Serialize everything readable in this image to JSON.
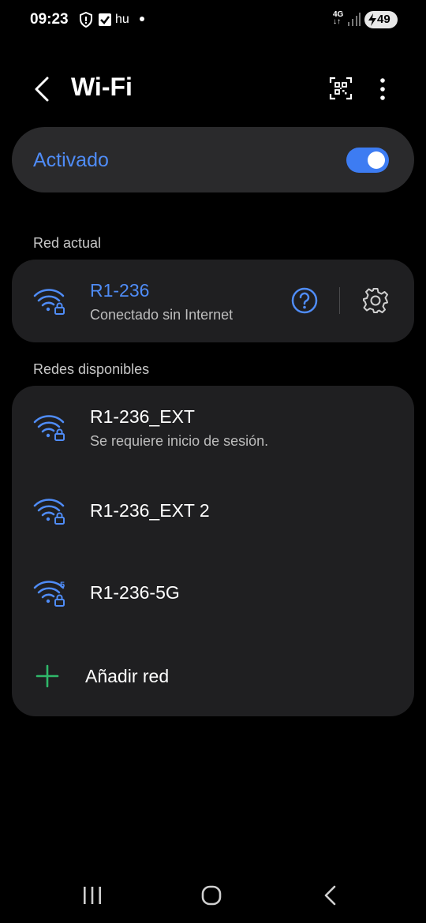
{
  "status_bar": {
    "time": "09:23",
    "carrier_text": "hu",
    "network_type": "4G",
    "battery": "49",
    "icons": [
      "shield-icon",
      "check-square-icon",
      "dot-icon",
      "signal-icon",
      "battery-charging-icon"
    ]
  },
  "header": {
    "title": "Wi-Fi",
    "icons": [
      "back-arrow-icon",
      "qr-code-icon",
      "more-vert-icon"
    ]
  },
  "wifi_toggle": {
    "label": "Activado",
    "on": true
  },
  "current_network": {
    "section_label": "Red actual",
    "name": "R1-236",
    "status": "Conectado sin Internet"
  },
  "available_networks": {
    "section_label": "Redes disponibles",
    "items": [
      {
        "name": "R1-236_EXT",
        "status": "Se requiere inicio de sesión."
      },
      {
        "name": "R1-236_EXT 2"
      },
      {
        "name": "R1-236-5G",
        "band_badge": "5"
      }
    ],
    "add_label": "Añadir red"
  },
  "colors": {
    "accent": "#4f8cf7",
    "card": "#1f1f21",
    "add_icon": "#2fb86a"
  }
}
